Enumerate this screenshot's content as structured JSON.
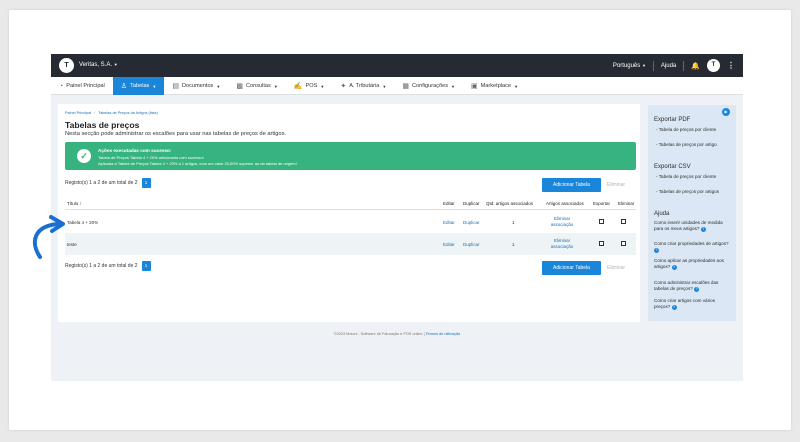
{
  "topbar": {
    "company": "Veritas, S.A.",
    "language": "Português",
    "help": "Ajuda"
  },
  "menu": [
    {
      "label": "Painel Principal",
      "icon": "gauge-icon"
    },
    {
      "label": "Tabelas",
      "icon": "users-icon",
      "active": true
    },
    {
      "label": "Documentos",
      "icon": "document-icon"
    },
    {
      "label": "Consultas",
      "icon": "chart-icon"
    },
    {
      "label": "POS",
      "icon": "pos-icon"
    },
    {
      "label": "A. Tributária",
      "icon": "tax-icon"
    },
    {
      "label": "Configurações",
      "icon": "settings-icon"
    },
    {
      "label": "Marketplace",
      "icon": "marketplace-icon"
    }
  ],
  "breadcrumb": {
    "home": "Painel Principal",
    "separator": "/",
    "current": "Tabelas de Preços de Artigos (lista)"
  },
  "page": {
    "title": "Tabelas de preços",
    "subtitle": "Nesta secção pode administrar os escalões para usar nas tabelas de preços de artigos."
  },
  "alert": {
    "title": "Ações executadas com sucesso:",
    "line1": "Tabela de Preços Tabela 4 + 20% adicionada com sucesso!",
    "line2": "Aplicada a Tabela de Preços Tabela 4 + 20% a 1 artigos, com um valor 20,00% superior ao da tabela de origem!"
  },
  "pagination": {
    "summary": "Registo(s) 1 a 2 de um total de 2",
    "page": "1"
  },
  "actions": {
    "add": "Adicionar Tabela",
    "delete": "Eliminar"
  },
  "table": {
    "headers": {
      "title": "Título",
      "edit": "Editar",
      "duplicate": "Duplicar",
      "qty": "Qtd. artigos associados",
      "articles": "Artigos associados",
      "export": "Exportar",
      "delete": "Eliminar"
    },
    "rows": [
      {
        "title": "Tabela 4 + 20%",
        "edit": "Editar",
        "duplicate": "Duplicar",
        "qty": "1",
        "articles": "Eliminar associação"
      },
      {
        "title": "teste",
        "edit": "Editar",
        "duplicate": "Duplicar",
        "qty": "1",
        "articles": "Eliminar associação"
      }
    ]
  },
  "sidebar": {
    "export_pdf": {
      "title": "Exportar PDF",
      "items": [
        "- Tabela de preços por cliente",
        "- Tabelas de preços por artigo"
      ]
    },
    "export_csv": {
      "title": "Exportar CSV",
      "items": [
        "- Tabela de preços por cliente",
        "- Tabelas de preços por artigos"
      ]
    },
    "help": {
      "title": "Ajuda",
      "items": [
        "Como inserir unidades de medida para os meus artigos?",
        "Como criar propriedades de artigos?",
        "Como aplicar as propriedades aos artigos?",
        "Como administrar escalões das tabelas de preços?",
        "Como criar artigos com vários preços?"
      ]
    }
  },
  "footer": {
    "text": "©2023 Moloni - Software de Faturação e POS online",
    "terms": "Termos de utilização"
  },
  "colors": {
    "primary": "#1a86d9",
    "success": "#36b37e",
    "topbar": "#262b33",
    "sidebar": "#dbe7f4",
    "arrow": "#1a6fd1"
  }
}
